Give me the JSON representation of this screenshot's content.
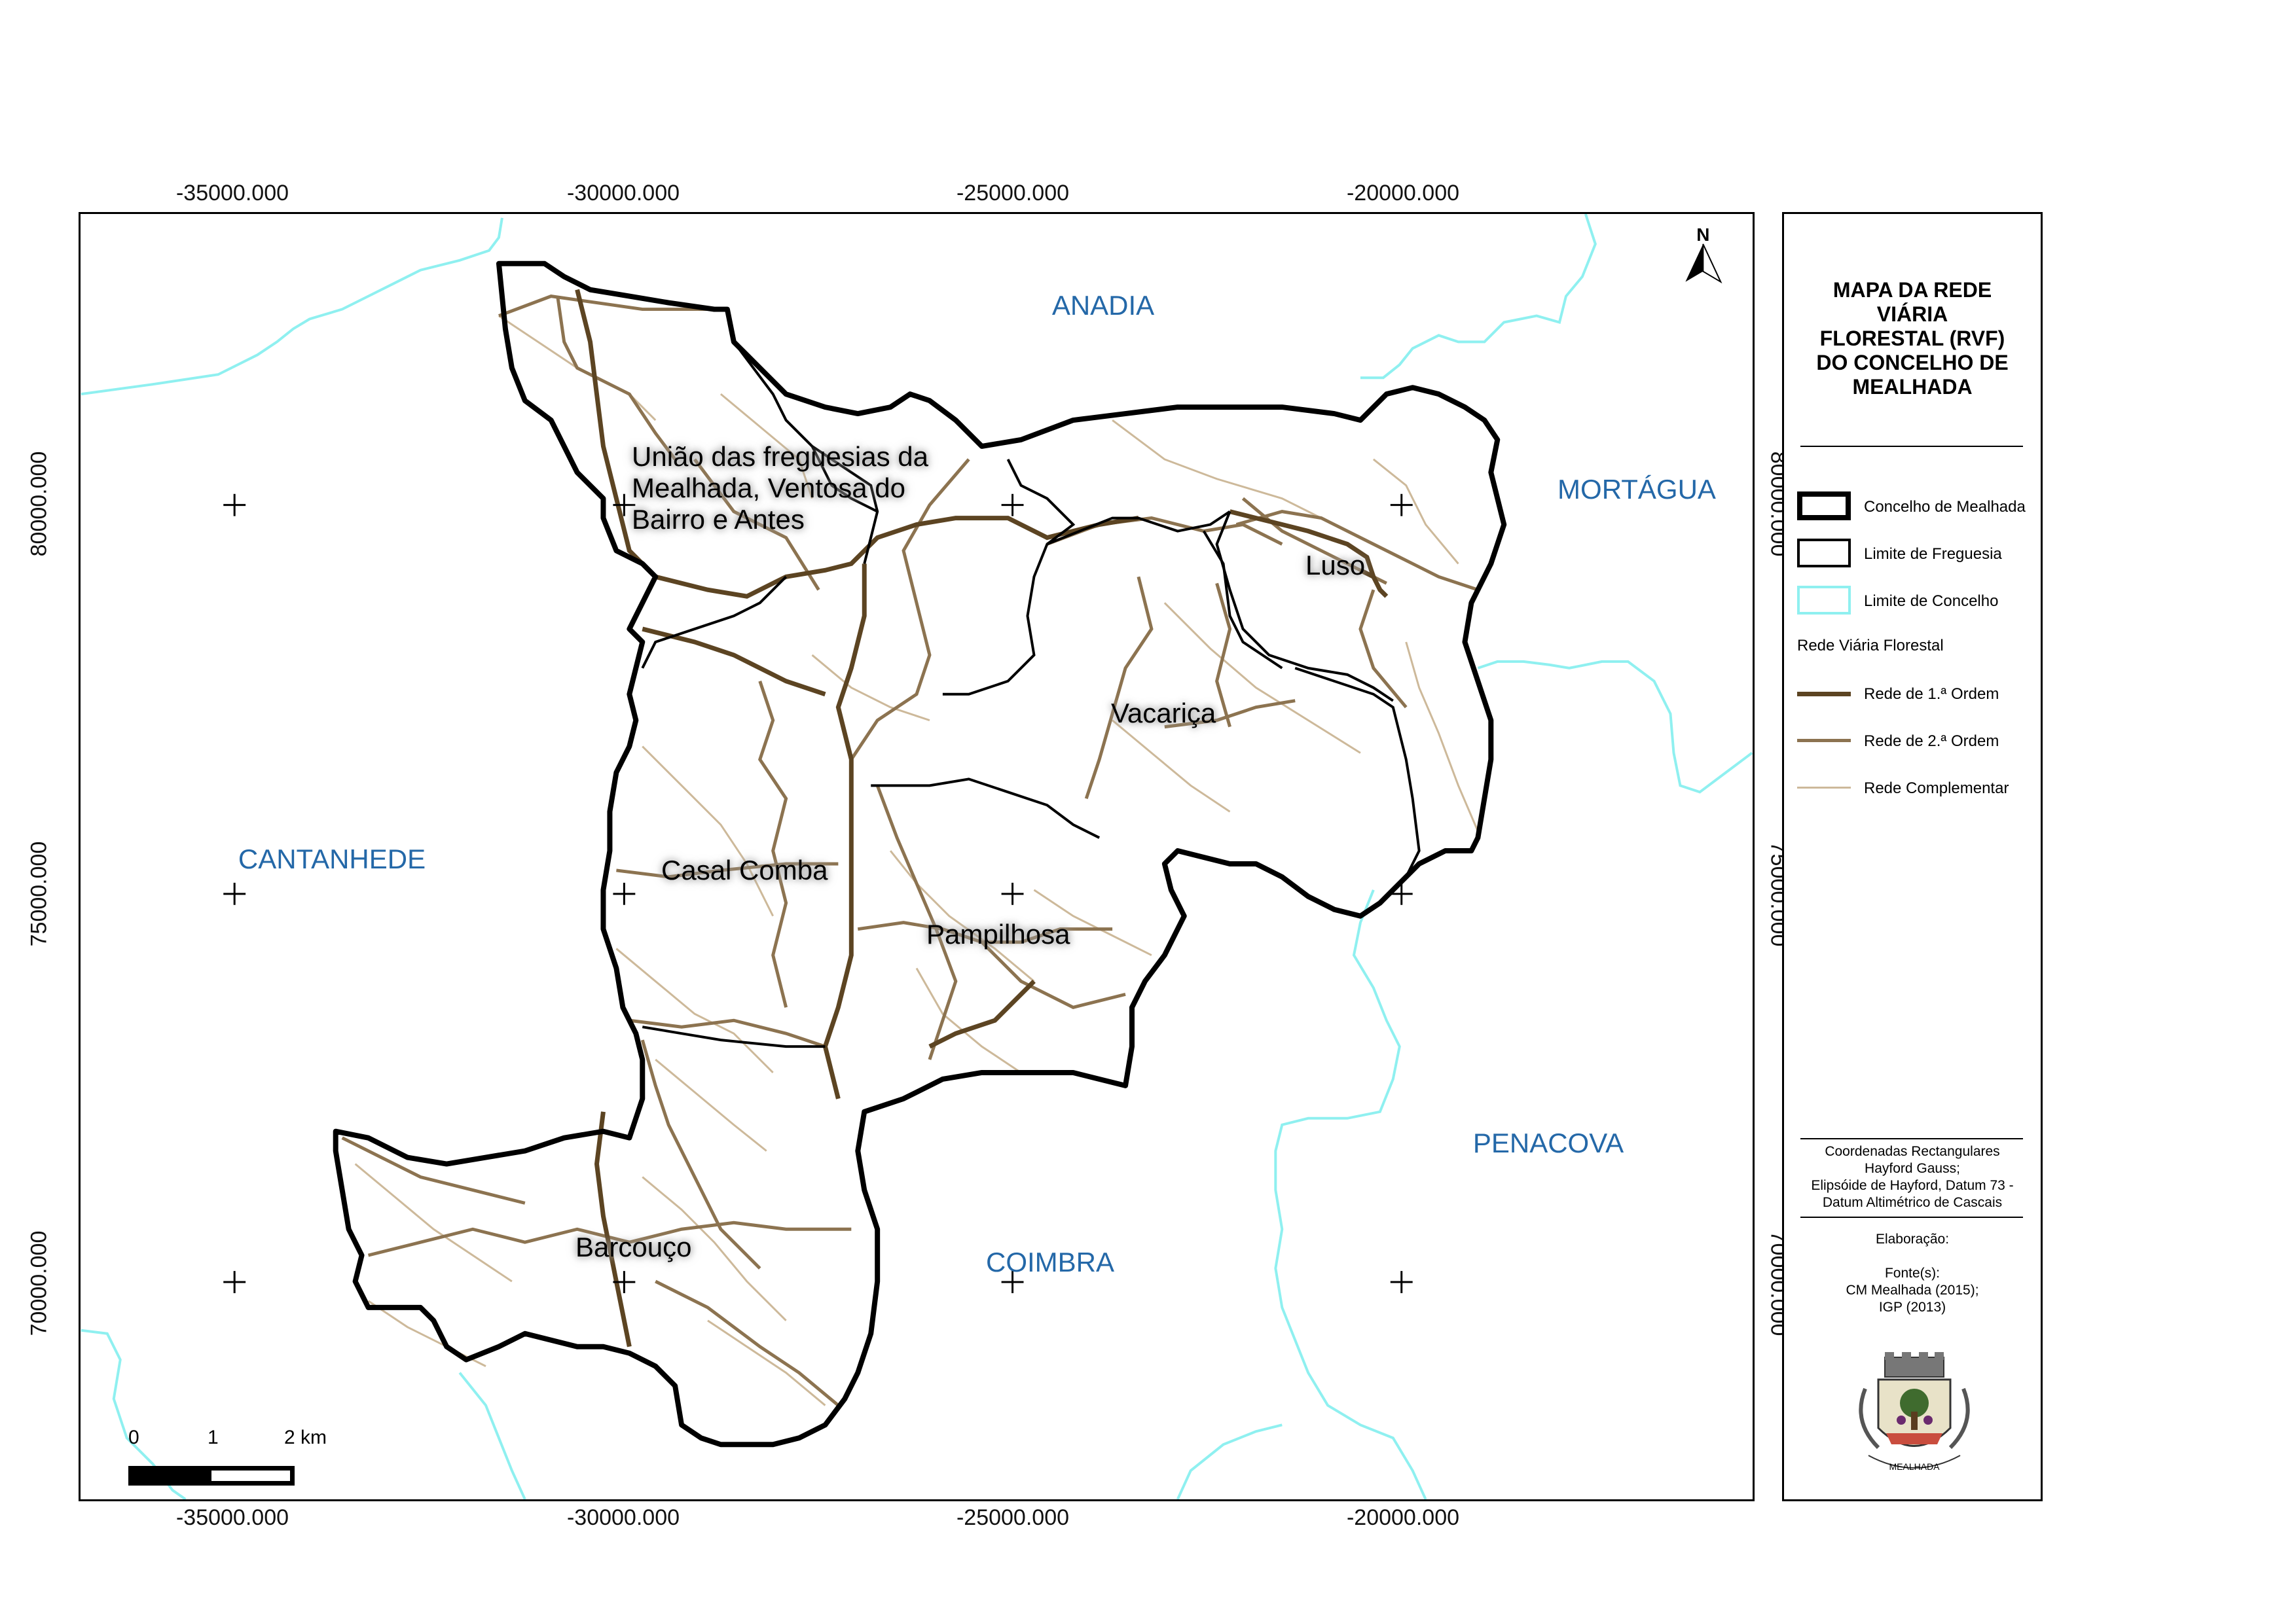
{
  "grid": {
    "top_x": [
      "-35000.000",
      "-30000.000",
      "-25000.000",
      "-20000.000"
    ],
    "bottom_x": [
      "-35000.000",
      "-30000.000",
      "-25000.000",
      "-20000.000"
    ],
    "left_y": [
      "80000.000",
      "75000.000",
      "70000.000"
    ],
    "right_y": [
      "80000.000",
      "75000.000",
      "70000.000"
    ]
  },
  "map": {
    "north_arrow_label": "N",
    "municipalities": [
      "ANADIA",
      "MORTÁGUA",
      "CANTANHEDE",
      "PENACOVA",
      "COIMBRA"
    ],
    "parishes": [
      "União das freguesias da\nMealhada, Ventosa do\nBairro e Antes",
      "Luso",
      "Vacariça",
      "Casal Comba",
      "Pampilhosa",
      "Barcouço"
    ],
    "scale_bar": {
      "labels": [
        "0",
        "1",
        "2 km"
      ]
    }
  },
  "legend": {
    "title": "MAPA DA REDE\nVIÁRIA\nFLORESTAL (RVF)\nDO CONCELHO DE\nMEALHADA",
    "items": [
      {
        "label": "Concelho de Mealhada",
        "stroke": "#000000"
      },
      {
        "label": "Limite de Freguesia",
        "stroke": "#000000"
      },
      {
        "label": "Limite de Concelho",
        "stroke": "#8ff0f0"
      }
    ],
    "network_header": "Rede Viária Florestal",
    "network_items": [
      {
        "label": "Rede de 1.ª Ordem",
        "color": "#5c4422"
      },
      {
        "label": "Rede de 2.ª Ordem",
        "color": "#8c7350"
      },
      {
        "label": "Rede Complementar",
        "color": "#cdb99a"
      }
    ],
    "projection_note": "Coordenadas Rectangulares\nHayford Gauss;\nElipsóide de Hayford, Datum 73 -\nDatum Altimétrico de Cascais",
    "elaboration": "Elaboração:",
    "sources": "Fonte(s):\nCM Mealhada (2015);\nIGP (2013)",
    "emblem_text": "MEALHADA"
  },
  "colors": {
    "municipality_label": "#2468a8",
    "county_limit": "#8ff0f0",
    "primary_road": "#5c4422",
    "secondary_road": "#8c7350",
    "complementary_road": "#cdb99a"
  }
}
